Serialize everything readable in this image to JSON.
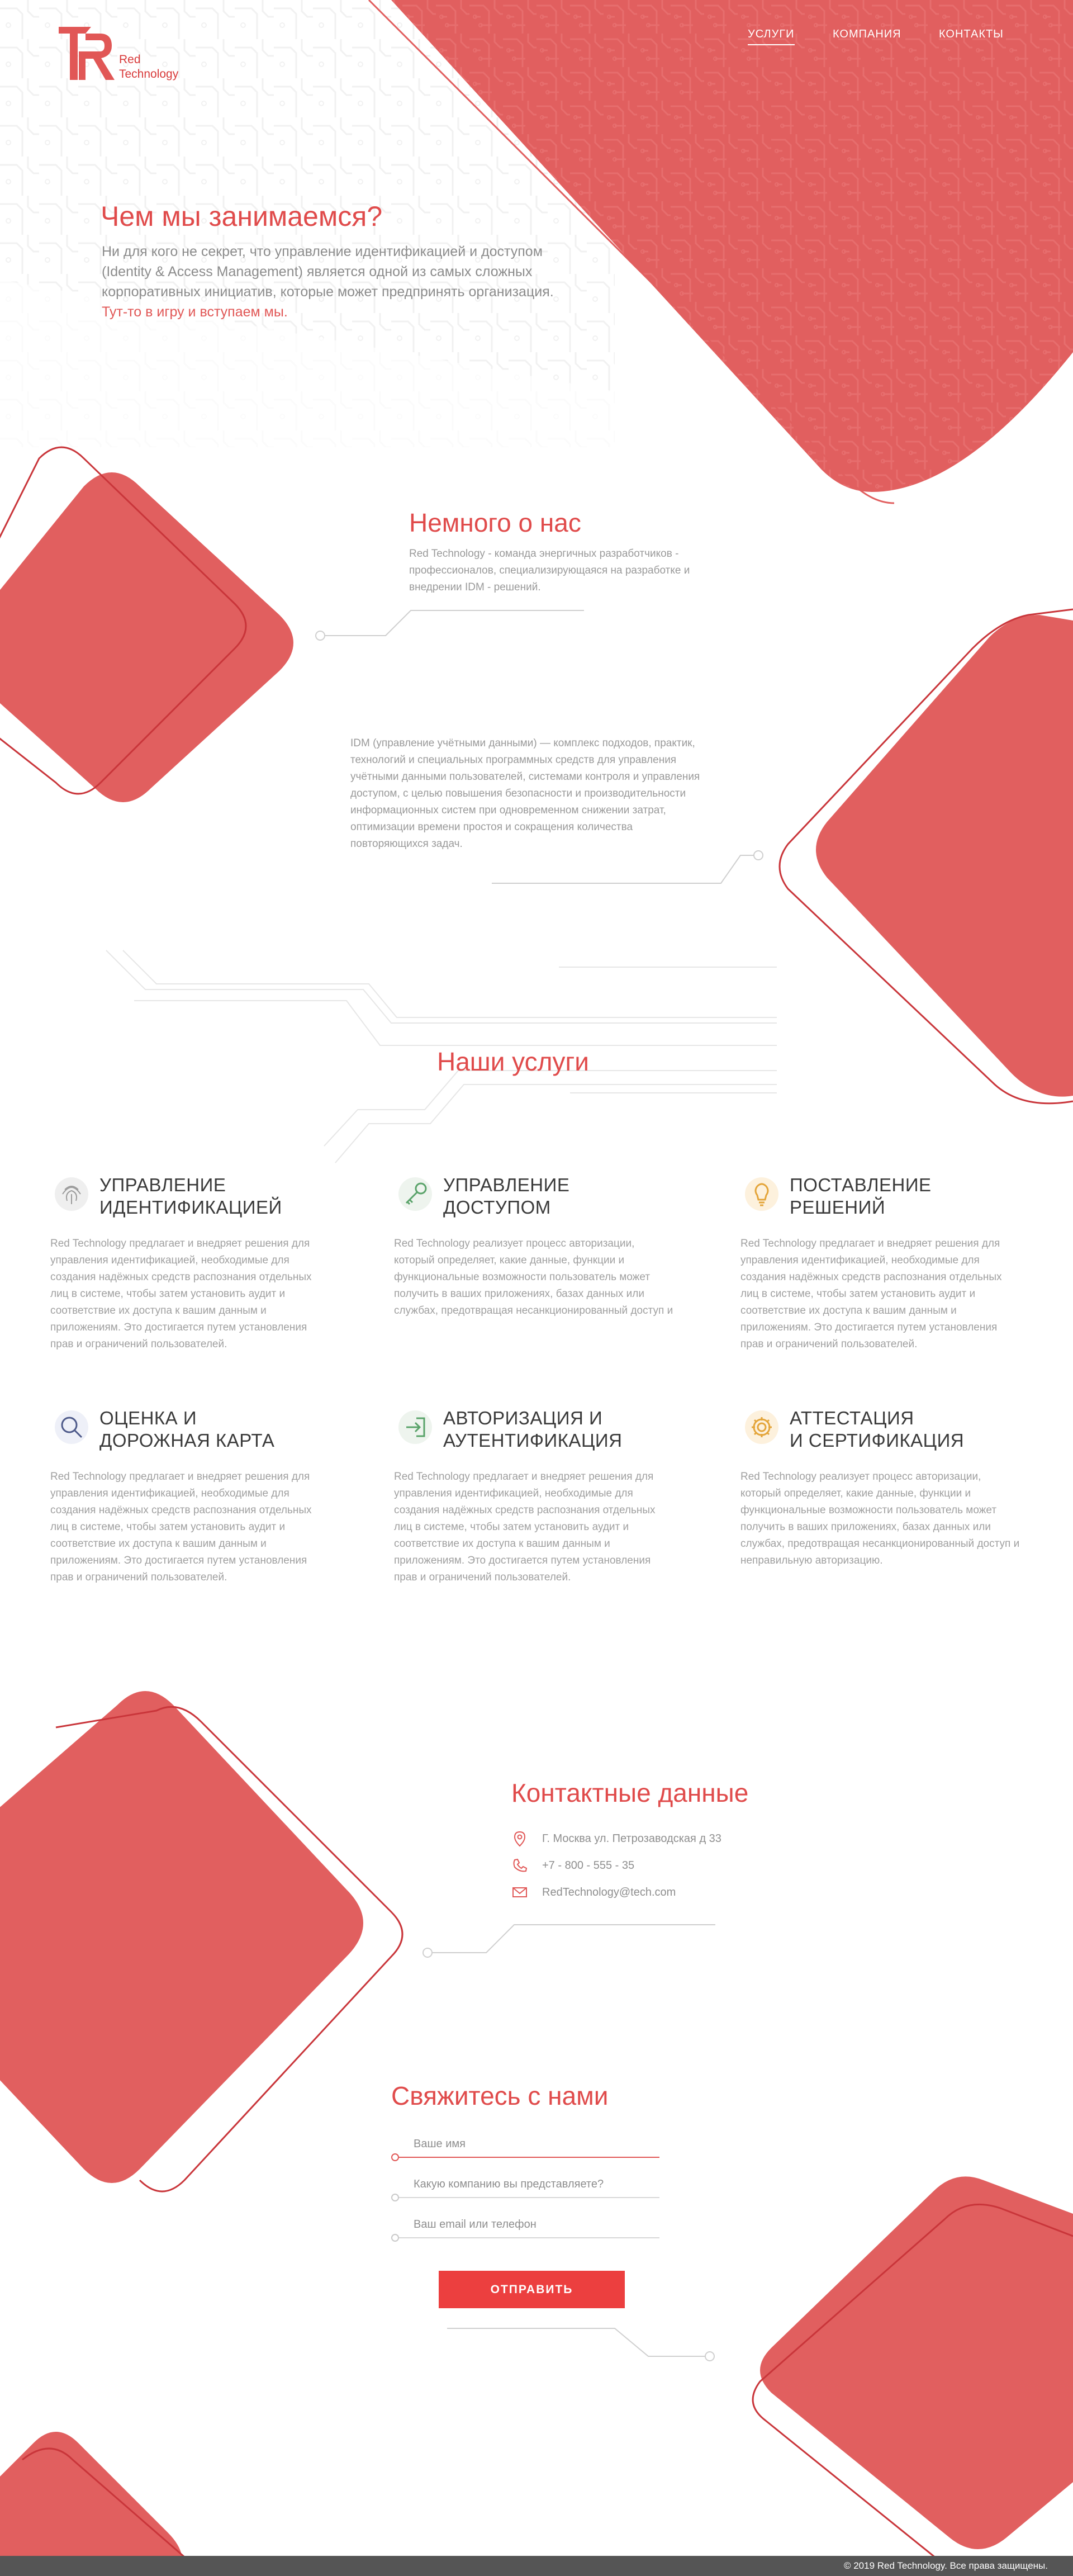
{
  "brand": {
    "name_line1": "Red",
    "name_line2": "Technology",
    "accent": "#e15756"
  },
  "nav": {
    "items": [
      {
        "label": "УСЛУГИ",
        "active": true
      },
      {
        "label": "КОМПАНИЯ",
        "active": false
      },
      {
        "label": "КОНТАКТЫ",
        "active": false
      }
    ]
  },
  "hero": {
    "title": "Чем мы занимаемся?",
    "text": "Ни для кого не секрет, что управление идентификацией и доступом (Identity & Access Management) является одной из самых сложных корпоративных инициатив, которые может предпринять организация.",
    "accent_text": "Тут-то в игру и вступаем мы."
  },
  "about": {
    "title": "Немного о нас",
    "text": "Red Technology - команда энергичных разработчиков - профессионалов, специализирующаяся на разработке и внедрении IDM - решений.",
    "idm_text": "IDM (управление учётными данными) — комплекс подходов, практик, технологий и специальных программных средств для управления учётными данными пользователей, системами контроля и управления доступом, с целью повышения безопасности и производительности информационных систем при одновременном снижении затрат, оптимизации времени простоя и сокращения количества повторяющихся задач."
  },
  "services": {
    "title": "Наши услуги",
    "items": [
      {
        "icon": "fingerprint-icon",
        "title_line1": "Управление",
        "title_line2": "идентификацией",
        "text": "Red Technology предлагает и внедряет решения для управления идентификацией, необходимые для создания надёжных средств распознания отдельных лиц в системе, чтобы затем установить аудит и соответствие их доступа к вашим данным и приложениям. Это достигается путем установления прав и ограничений пользователей."
      },
      {
        "icon": "key-icon",
        "title_line1": "Управление",
        "title_line2": "доступом",
        "text": "Red Technology реализует процесс авторизации, который определяет, какие данные, функции и функциональные возможности пользователь может получить в ваших приложениях, базах данных или службах, предотвращая несанкционированный доступ и"
      },
      {
        "icon": "lightbulb-icon",
        "title_line1": "Поставление",
        "title_line2": "решений",
        "text": "Red Technology предлагает и внедряет решения для управления идентификацией, необходимые для создания надёжных средств распознания отдельных лиц в системе, чтобы затем установить аудит и соответствие их доступа к вашим данным и приложениям. Это достигается путем установления прав и ограничений пользователей."
      },
      {
        "icon": "magnifier-icon",
        "title_line1": "Оценка и",
        "title_line2": "дорожная карта",
        "text": "Red Technology предлагает и внедряет решения для управления идентификацией, необходимые для создания надёжных средств распознания отдельных лиц в системе, чтобы затем установить аудит и соответствие их доступа к вашим данным и приложениям. Это достигается путем установления прав и ограничений пользователей."
      },
      {
        "icon": "login-icon",
        "title_line1": "Авторизация и",
        "title_line2": "аутентификация",
        "text": "Red Technology предлагает и внедряет решения для управления идентификацией, необходимые для создания надёжных средств распознания отдельных лиц в системе, чтобы затем установить аудит и соответствие их доступа к вашим данным и приложениям. Это достигается путем установления прав и ограничений пользователей."
      },
      {
        "icon": "gear-icon",
        "title_line1": "Аттестация",
        "title_line2": "и сертификация",
        "text": "Red Technology реализует процесс авторизации, который определяет, какие данные, функции и функциональные возможности пользователь может получить в ваших приложениях, базах данных или службах, предотвращая несанкционированный доступ и неправильную авторизацию."
      }
    ]
  },
  "contacts": {
    "title": "Контактные данные",
    "address": "Г. Москва ул. Петрозаводская д 33",
    "phone": "+7 - 800 - 555 - 35",
    "email": "RedTechnology@tech.com"
  },
  "form": {
    "title": "Свяжитесь с нами",
    "name_placeholder": "Ваше имя",
    "company_placeholder": "Какую компанию вы представляете?",
    "contact_placeholder": "Ваш email или телефон",
    "submit_label": "Отправить"
  },
  "footer": {
    "copyright": "© 2019 Red Technology. Все права защищены."
  }
}
